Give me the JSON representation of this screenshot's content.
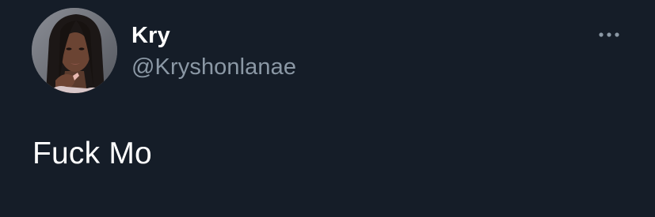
{
  "tweet": {
    "author": {
      "display_name": "Kry",
      "handle": "@Kryshonlanae",
      "avatar_icon": "profile-photo"
    },
    "text": "Fuck Mo",
    "more_icon": "more-horizontal-icon"
  },
  "colors": {
    "background": "#151d28",
    "primary_text": "#ffffff",
    "secondary_text": "#8b98a5"
  }
}
